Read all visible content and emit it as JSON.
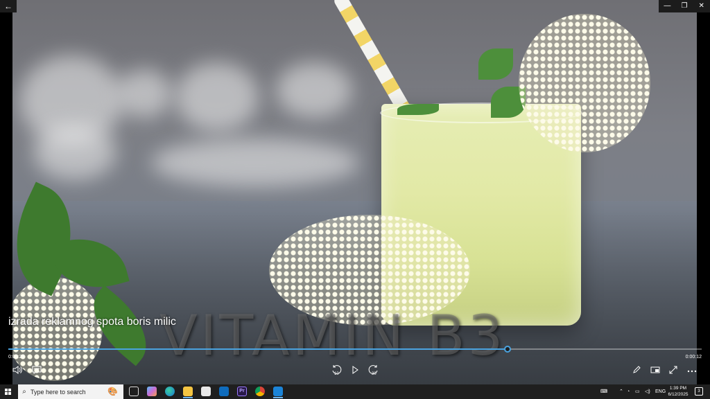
{
  "window": {
    "back_glyph": "←",
    "minimize_glyph": "—",
    "restore_glyph": "❐",
    "close_glyph": "✕"
  },
  "video": {
    "watermark_text": "VITAMIN B3",
    "title": "izrada reklamnog spota boris milic",
    "progress_fraction": 0.72
  },
  "player": {
    "elapsed": "0:00:28",
    "remaining": "0:00:12",
    "skip_back_label": "10",
    "skip_forward_label": "30",
    "volume_icon": "volume-icon",
    "captions_icon": "captions-icon",
    "play_icon": "play-icon",
    "edit_icon": "pencil-icon",
    "miniview_icon": "miniview-icon",
    "fullscreen_icon": "fullscreen-icon",
    "more_icon": "more-icon"
  },
  "taskbar": {
    "search_placeholder": "Type here to search",
    "pinned_apps": [
      "task-view",
      "copilot",
      "edge",
      "file-explorer",
      "store",
      "outlook",
      "premiere-pro",
      "chrome",
      "movies-tv"
    ],
    "pr_label": "Pr",
    "tray_language": "ENG",
    "clock_time": "1:39 PM",
    "clock_date": "6/12/2025",
    "notification_count": "3"
  },
  "colors": {
    "accent": "#4aa3e0",
    "taskbar": "#1f1f1f",
    "premiere": "#2a1a4a"
  }
}
